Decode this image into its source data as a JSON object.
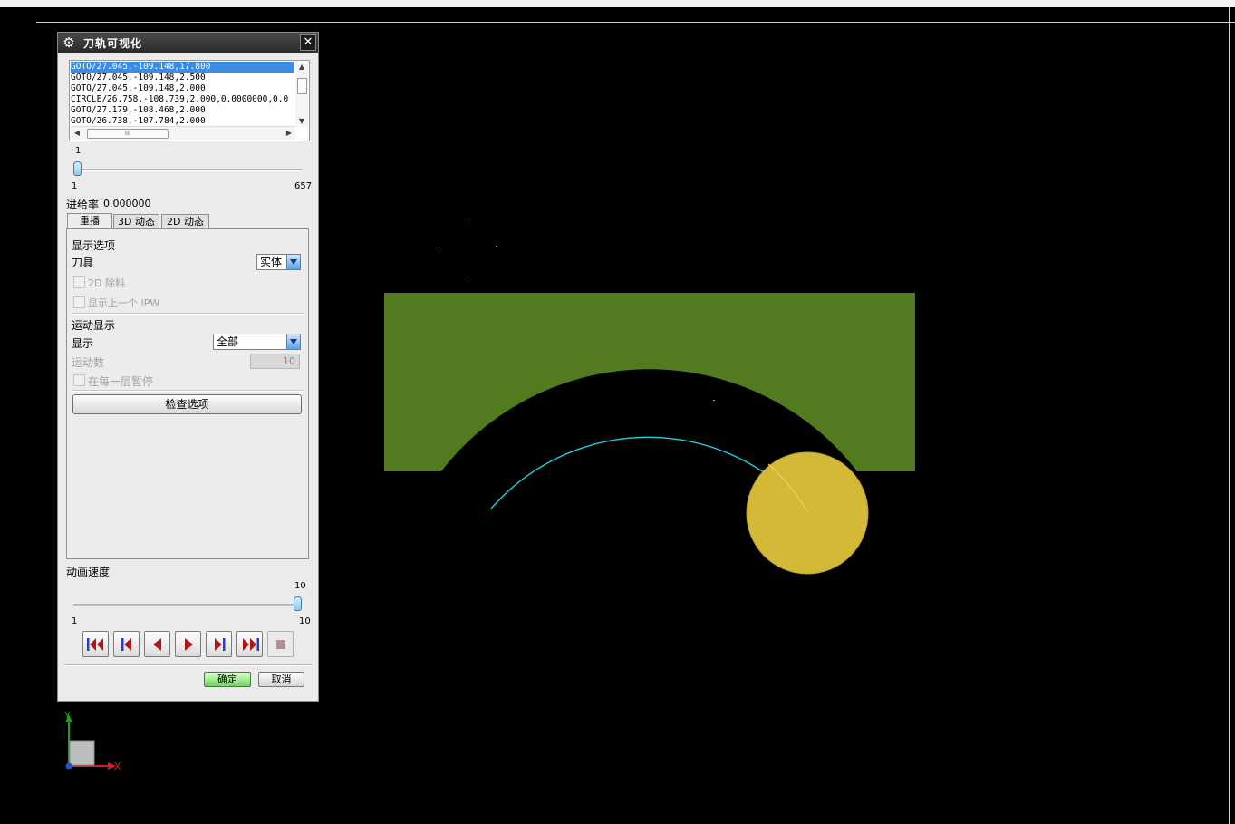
{
  "dialog": {
    "title": "刀轨可视化",
    "list_items": [
      "GOTO/27.045,-109.148,17.800",
      "GOTO/27.045,-109.148,2.500",
      "GOTO/27.045,-109.148,2.000",
      "CIRCLE/26.758,-108.739,2.000,0.0000000,0.0",
      "GOTO/27.179,-108.468,2.000",
      "GOTO/26.738,-107.784,2.000"
    ],
    "hscroll_thumb": "III",
    "motion_slider": {
      "current": "1",
      "min": "1",
      "max": "657",
      "value": 1
    },
    "feed_label": "进给率",
    "feed_value": "0.000000",
    "tabs": [
      "重播",
      "3D 动态",
      "2D 动态"
    ],
    "display_options_label": "显示选项",
    "tool_label": "刀具",
    "tool_value": "实体",
    "remove_2d_label": "2D 除料",
    "show_prev_ipw_label": "显示上一个 IPW",
    "motion_display_label": "运动显示",
    "display_label": "显示",
    "display_value": "全部",
    "motion_count_label": "运动数",
    "motion_count_value": "10",
    "pause_each_layer_label": "在每一层暂停",
    "check_options_label": "检查选项",
    "speed_label": "动画速度",
    "speed_slider": {
      "current": "10",
      "min": "1",
      "max": "10",
      "value": 10
    },
    "ok_label": "确定",
    "cancel_label": "取消"
  },
  "triad": {
    "x_label": "X",
    "y_label": "Y"
  },
  "colors": {
    "part": "#527b20",
    "tool": "#d4b838",
    "toolpath": "#20d0e0",
    "background": "#000000"
  }
}
